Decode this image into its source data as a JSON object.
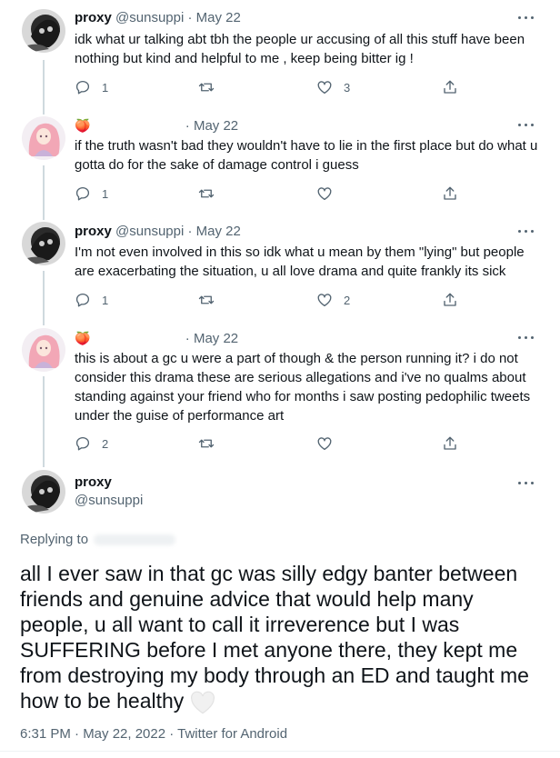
{
  "tweets": [
    {
      "name": "proxy",
      "handle": "@sunsuppi",
      "dot": "·",
      "date": "May 22",
      "text": "idk what ur talking abt tbh the people ur accusing of all this stuff have been nothing but kind and helpful to me , keep being bitter ig !",
      "replies": "1",
      "retweets": "",
      "likes": "3"
    },
    {
      "name": "🍑",
      "handle": "",
      "dot": "·",
      "date": "May 22",
      "text": "if the truth wasn't bad they wouldn't have to lie in the first place but do what u gotta do for the sake of damage control i guess",
      "replies": "1",
      "retweets": "",
      "likes": ""
    },
    {
      "name": "proxy",
      "handle": "@sunsuppi",
      "dot": "·",
      "date": "May 22",
      "text": "I'm not even involved in this so idk what u mean by them \"lying\" but people are exacerbating the situation, u all love drama and quite frankly its sick",
      "replies": "1",
      "retweets": "",
      "likes": "2"
    },
    {
      "name": "🍑",
      "handle": "",
      "dot": "·",
      "date": "May 22",
      "text": "this is about a gc u were a part of though & the person running it? i do not consider this drama these are serious allegations and i've no qualms about standing against your friend  who for months i saw posting pedophilic tweets under the guise of performance art",
      "replies": "2",
      "retweets": "",
      "likes": ""
    }
  ],
  "main": {
    "name": "proxy",
    "handle": "@sunsuppi",
    "replying_to": "Replying to",
    "text": "all I ever saw in that gc was silly edgy banter between friends and genuine advice that would help many people, u all want to call it irreverence but I was SUFFERING before I met anyone there, they kept me from destroying my body through an ED and taught me how to be healthy",
    "meta": "6:31 PM · May 22, 2022 · Twitter for Android"
  },
  "icons": {
    "reply": "reply-icon",
    "retweet": "retweet-icon",
    "like": "heart-icon",
    "share": "share-icon",
    "more": "more-icon"
  },
  "colors": {
    "text": "#0f1419",
    "secondary": "#536471",
    "thread_line": "#cfd9de"
  }
}
